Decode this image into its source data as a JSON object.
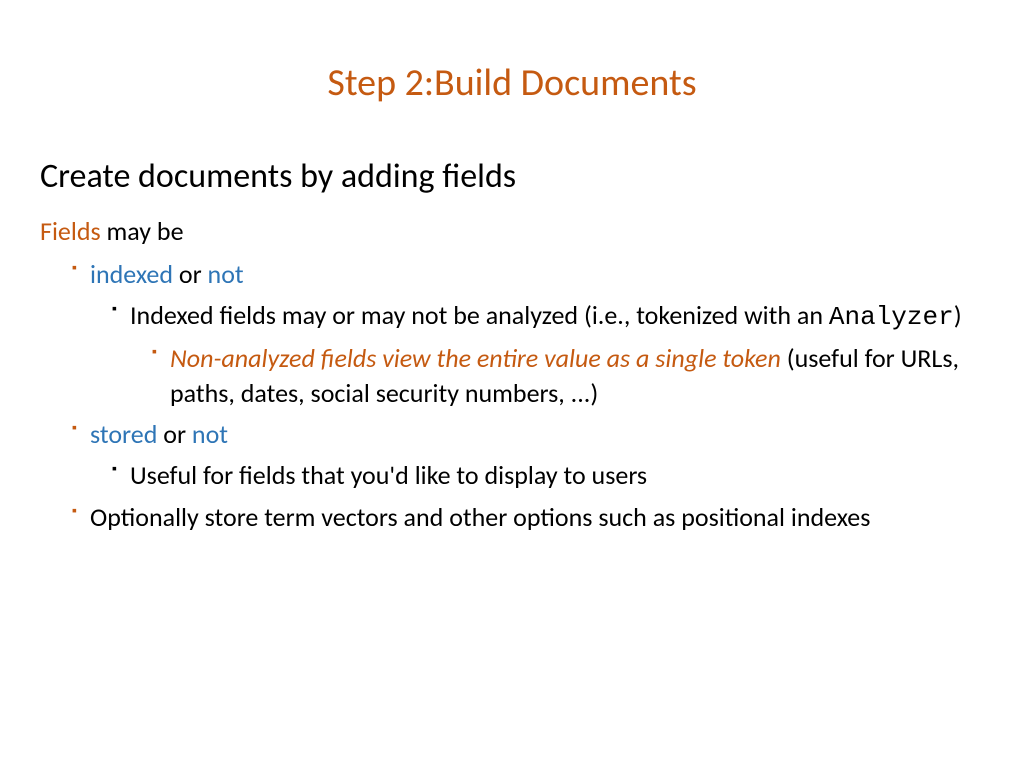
{
  "title": "Step 2:Build Documents",
  "subtitle": "Create documents by adding fields",
  "fields_prefix": "Fields",
  "fields_suffix": " may be",
  "b1a_word1": "indexed",
  "b1a_or": " or ",
  "b1a_word2": "not",
  "b2a_part1": "Indexed fields may or may not be analyzed (i.e., tokenized with an ",
  "b2a_mono": "Analyzer",
  "b2a_part2": ")",
  "b3a_italic": "Non-analyzed fields view the entire value as a single token",
  "b3a_rest": " (useful for URLs, paths, dates, social security numbers, ...)",
  "b1b_word1": "stored",
  "b1b_or": " or ",
  "b1b_word2": "not",
  "b2b": "Useful for fields that you'd like to display to users",
  "b1c": "Optionally store term vectors and other options such as positional indexes"
}
